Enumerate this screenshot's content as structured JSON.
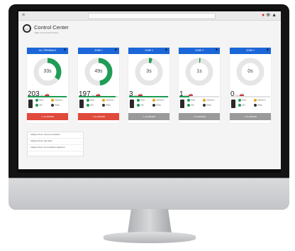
{
  "app": {
    "title": "Control Center",
    "subtitle": "Bjølt | Universitet Muspel"
  },
  "topbar": {
    "menu_icon": "≡",
    "icons": [
      "bell-alert-icon",
      "globe-icon",
      "user-icon"
    ]
  },
  "cards": [
    {
      "header": "ALL TERMINALS",
      "plus": "+",
      "timer": "33s",
      "timer_fraction": 0.35,
      "count": "203",
      "unit": "min",
      "progress_fraction": 0.99,
      "status": "ALARMER",
      "status_color": "red",
      "legend": [
        "Aktive",
        "Udebleven",
        "Låst",
        "Afslag"
      ]
    },
    {
      "header": "ZONE 1",
      "plus": "+",
      "timer": "49s",
      "timer_fraction": 0.48,
      "count": "197",
      "unit": "min",
      "progress_fraction": 0.93,
      "status": "ALARMER",
      "status_color": "red",
      "legend": [
        "Aktive",
        "Udebleven",
        "Låst",
        "Afslag"
      ]
    },
    {
      "header": "ZONE 2",
      "plus": "+",
      "timer": "3s",
      "timer_fraction": 0.04,
      "count": "3",
      "unit": "min",
      "progress_fraction": 0.99,
      "status": "ALARMER",
      "status_color": "grey",
      "legend": [
        "Aktive",
        "Udebleven",
        "Låst",
        "Afslag"
      ]
    },
    {
      "header": "ZONE 3",
      "plus": "+",
      "timer": "1s",
      "timer_fraction": 0.015,
      "count": "1",
      "unit": "min",
      "progress_fraction": 0.25,
      "status": "ALARMER",
      "status_color": "grey",
      "legend": [
        "Aktive",
        "Udebleven",
        "Låst",
        "Afslag"
      ]
    },
    {
      "header": "ZONE 4",
      "plus": "+",
      "timer": "0s",
      "timer_fraction": 0.0,
      "count": "0",
      "unit": "min",
      "progress_fraction": 0.0,
      "status": "ALARMER",
      "status_color": "grey",
      "legend": [
        "Aktive",
        "Udebleven",
        "Låst",
        "Afslag"
      ]
    }
  ],
  "legend_colors": [
    "#1f9d55",
    "#e8a21a",
    "#1f9d55",
    "#333333"
  ],
  "alerts": [
    {
      "text": "Afslag fra Zone: sensor test afsluttet"
    },
    {
      "text": "Afslag fra Zone: ikke aktivt"
    },
    {
      "text": "Afslag fra Zone: kommunikation fejlede tid"
    }
  ],
  "colors": {
    "accent": "#1b66d8",
    "green": "#1f9d55",
    "red": "#e04a3c"
  }
}
